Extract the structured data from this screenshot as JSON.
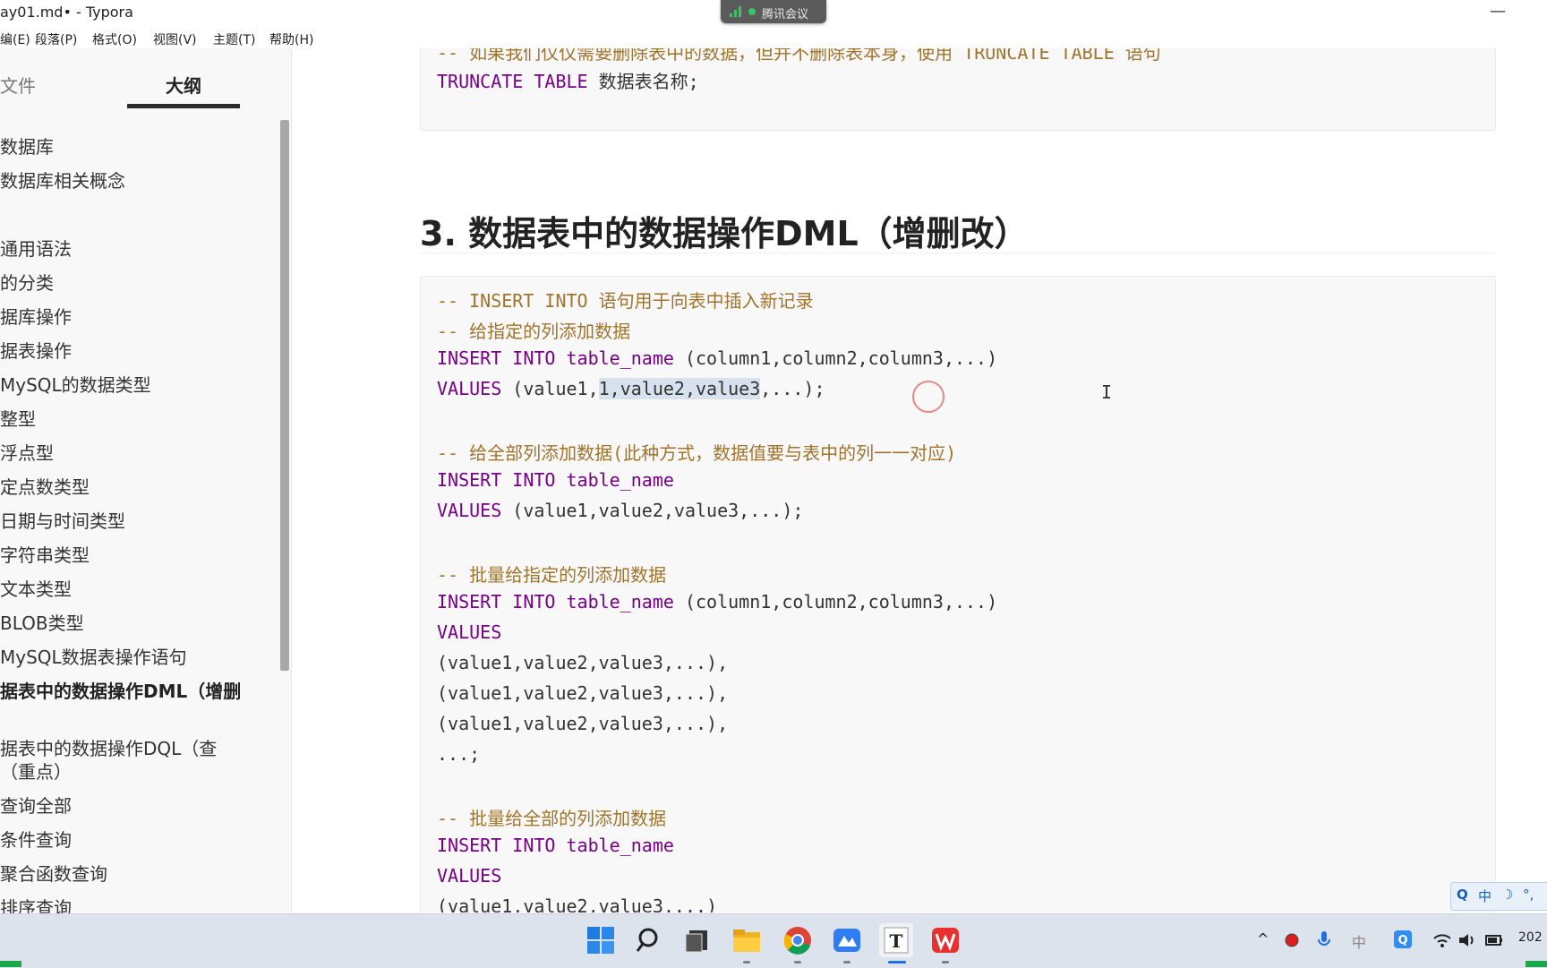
{
  "window": {
    "title": "ay01.md• - Typora",
    "minimize_glyph": "—",
    "meeting_label": "腾讯会议"
  },
  "menu": [
    "编(E)",
    "段落(P)",
    "格式(O)",
    "视图(V)",
    "主题(T)",
    "帮助(H)"
  ],
  "sidebar": {
    "tab_files": "文件",
    "tab_outline": "大纲",
    "items": [
      "数据库",
      "数据库相关概念",
      "通用语法",
      "的分类",
      "据库操作",
      "据表操作",
      " MySQL的数据类型",
      "整型",
      "浮点型",
      "定点数类型",
      "日期与时间类型",
      "字符串类型",
      "文本类型",
      "BLOB类型",
      " MySQL数据表操作语句",
      "据表中的数据操作DML（增删",
      "据表中的数据操作DQL（查",
      "（重点）",
      " 查询全部",
      " 条件查询",
      " 聚合函数查询",
      " 排序查询"
    ],
    "footer_back": "‹",
    "footer_source": "</>"
  },
  "editor": {
    "block1": {
      "line_partial": "-- 如果我们仅仅需要删除表中的数据，但并不删除表本身，使用 TRUNCATE TABLE 语句",
      "line_kw": "TRUNCATE TABLE",
      "line_text": " 数据表名称;"
    },
    "heading": "3. 数据表中的数据操作DML（增删改）",
    "code": {
      "c1": "-- INSERT INTO 语句用于向表中插入新记录",
      "c2": "-- 给指定的列添加数据",
      "l3_kw": "INSERT INTO table_name",
      "l3_rest": "(column1,column2,column3,...)",
      "l4_kw": "VALUES",
      "l4_a": "(value1,",
      "l4_sel": "1,value2,value3",
      "l4_b": ",...);",
      "c5": "-- 给全部列添加数据(此种方式，数据值要与表中的列一一对应)",
      "l6_kw": "INSERT INTO table_name",
      "l7_kw": "VALUES",
      "l7_rest": "(value1,value2,value3,...);",
      "c8": "-- 批量给指定的列添加数据",
      "l9_kw": "INSERT INTO table_name",
      "l9_rest": "(column1,column2,column3,...)",
      "l10_kw": "VALUES",
      "l11": "(value1,value2,value3,...),",
      "l12": "(value1,value2,value3,...),",
      "l13": "(value1,value2,value3,...),",
      "l14": "...;",
      "c15": "-- 批量给全部的列添加数据",
      "l16_kw": "INSERT INTO table_name",
      "l17_kw": "VALUES",
      "l18": "(value1,value2,value3,...)"
    },
    "ime": {
      "q": "Q",
      "mode": "中",
      "moon": "☽",
      "dots": "°,"
    }
  },
  "taskbar": {
    "clock_partial": "202",
    "tray_chevron": "^",
    "tray_ime": "中"
  }
}
